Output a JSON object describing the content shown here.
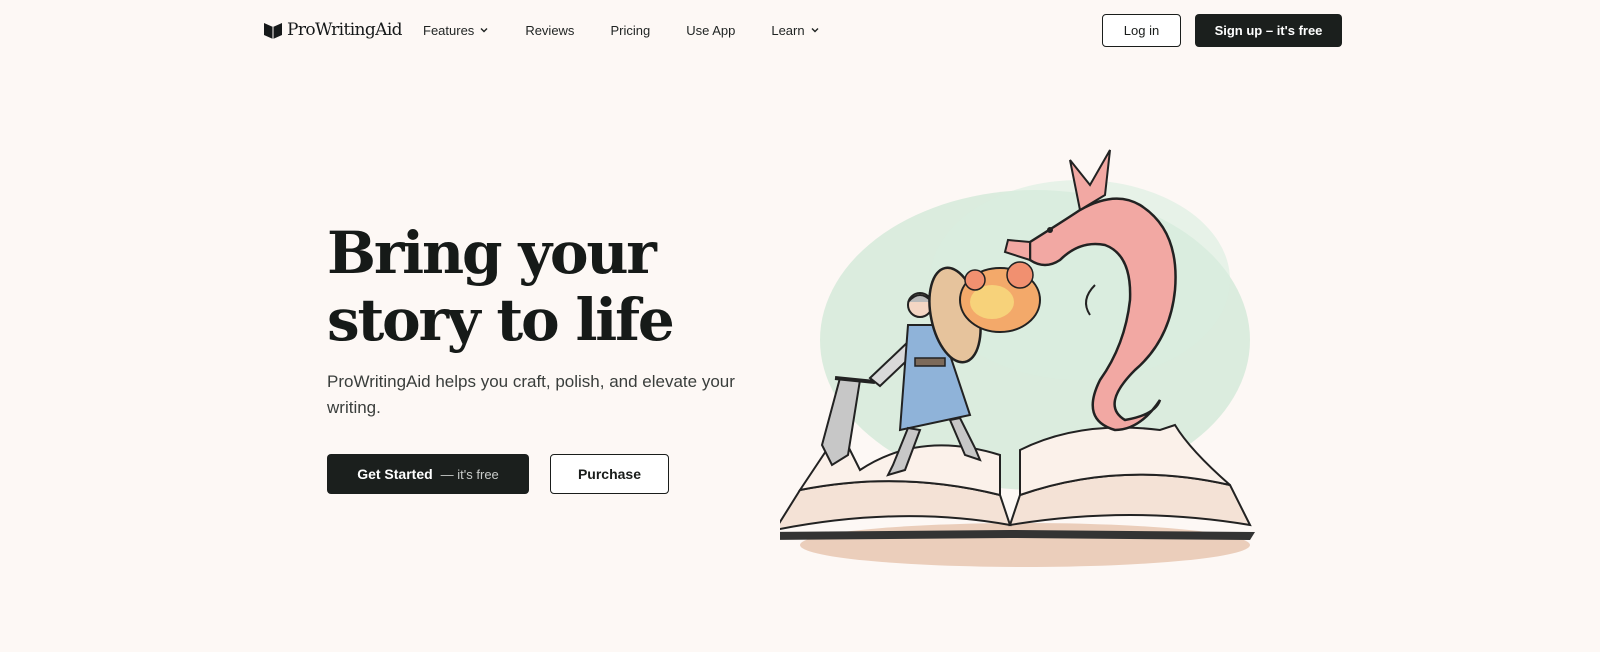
{
  "brand": {
    "name": "ProWritingAid"
  },
  "nav": {
    "items": [
      {
        "label": "Features",
        "dropdown": true
      },
      {
        "label": "Reviews",
        "dropdown": false
      },
      {
        "label": "Pricing",
        "dropdown": false
      },
      {
        "label": "Use App",
        "dropdown": false
      },
      {
        "label": "Learn",
        "dropdown": true
      }
    ],
    "login_label": "Log in",
    "signup_label": "Sign up – it's free"
  },
  "hero": {
    "title_line1": "Bring your",
    "title_line2": "story to life",
    "subtitle": "ProWritingAid helps you craft, polish, and elevate your writing.",
    "cta_primary": "Get Started",
    "cta_primary_aux": "— it's free",
    "cta_secondary": "Purchase"
  },
  "colors": {
    "background": "#fdf8f5",
    "primary_dark": "#1b1f1d",
    "dragon": "#f2a8a3",
    "knight_tunic": "#8fb3d9",
    "wash_green": "#cfe8d6"
  },
  "icons": {
    "logo": "book-logo-icon",
    "dropdown": "chevron-down-icon"
  }
}
